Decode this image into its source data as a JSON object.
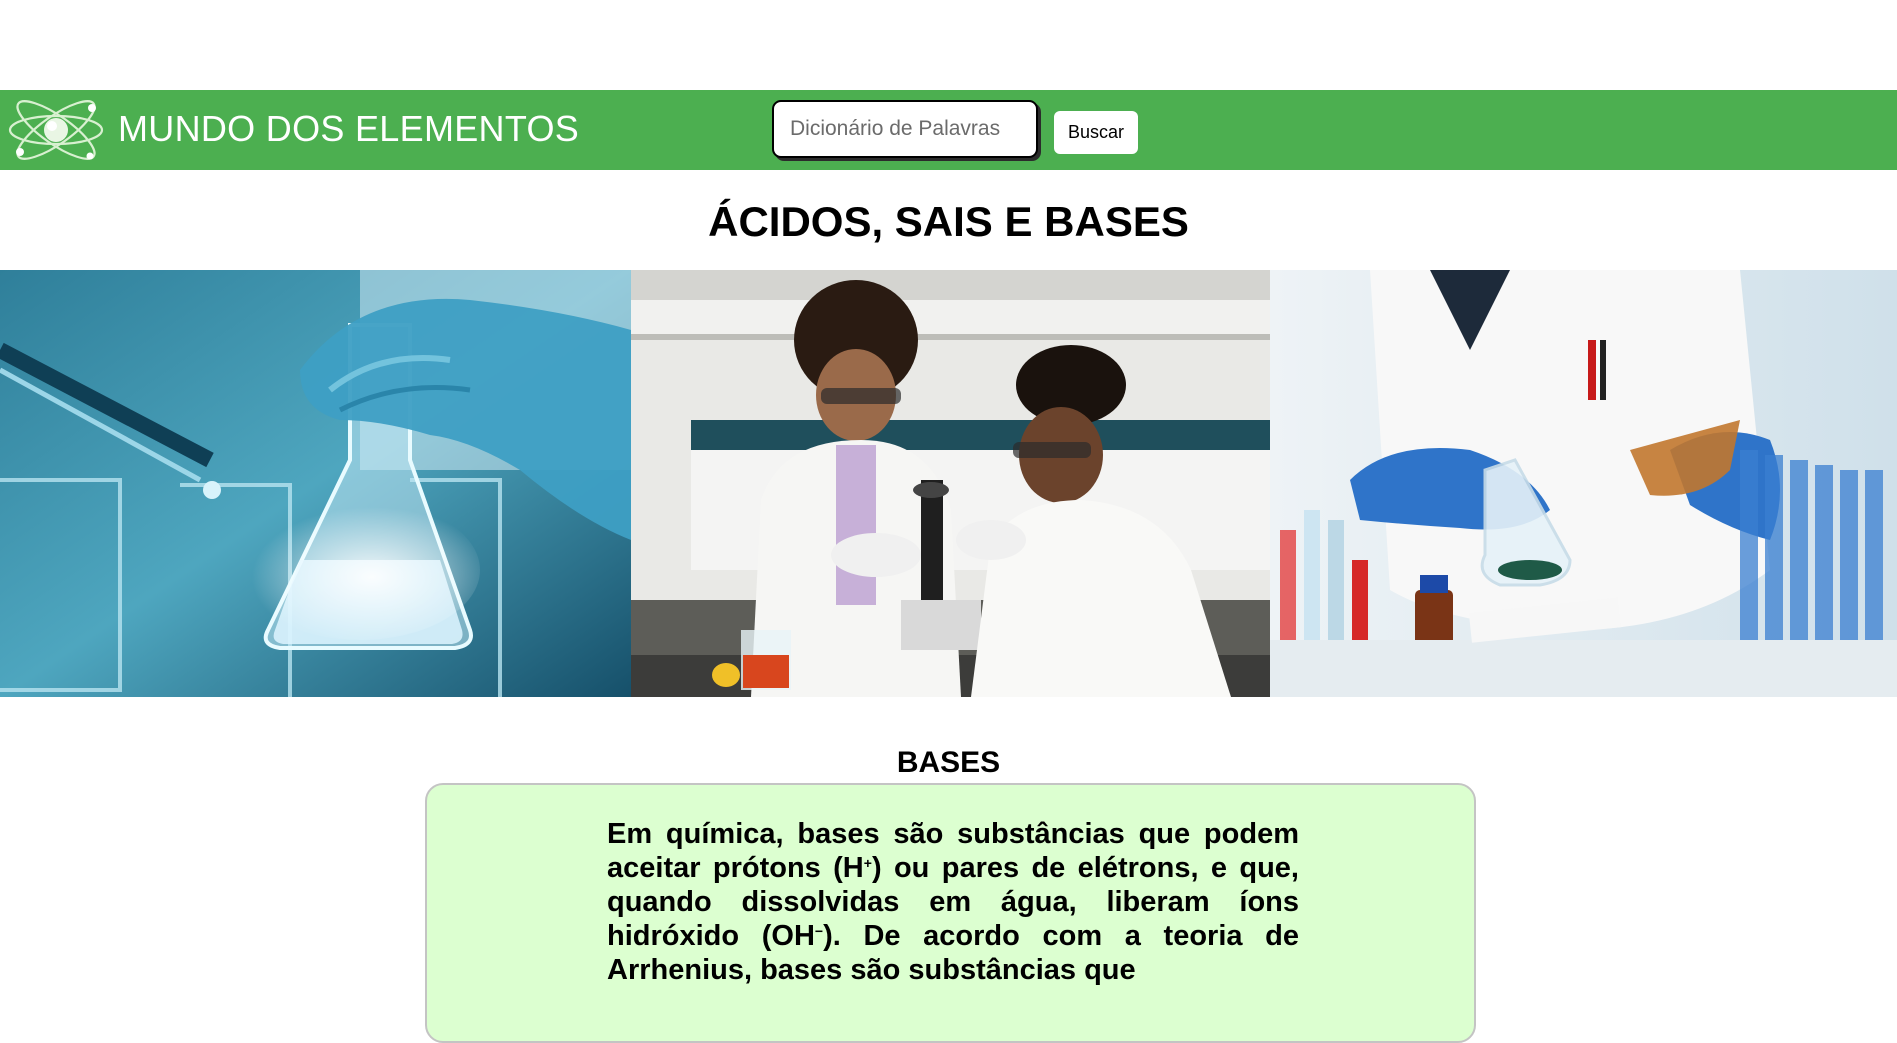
{
  "header": {
    "site_title": "MUNDO DOS ELEMENTOS",
    "logo_icon": "atom-icon",
    "search": {
      "placeholder": "Dicionário de Palavras",
      "value": ""
    },
    "search_button_label": "Buscar",
    "background_color": "#4caf50"
  },
  "page": {
    "title": "ÁCIDOS, SAIS E BASES"
  },
  "gallery": {
    "images": [
      {
        "icon": "erlenmeyer-flask-photo",
        "alt": ""
      },
      {
        "icon": "scientists-microscope-photo",
        "alt": ""
      },
      {
        "icon": "chemist-pouring-liquid-photo",
        "alt": ""
      }
    ]
  },
  "bases": {
    "title": "BASES",
    "card_background": "#dcffd0",
    "text": {
      "part1": "Em química, bases são substâncias que podem aceitar prótons (H",
      "sup1": "+",
      "part2": ") ou pares de elétrons, e que, quando dissolvidas em água, liberam íons hidróxido (OH",
      "sup2": "−",
      "part3": "). De acordo com a teoria de Arrhenius, bases são substâncias que"
    }
  }
}
